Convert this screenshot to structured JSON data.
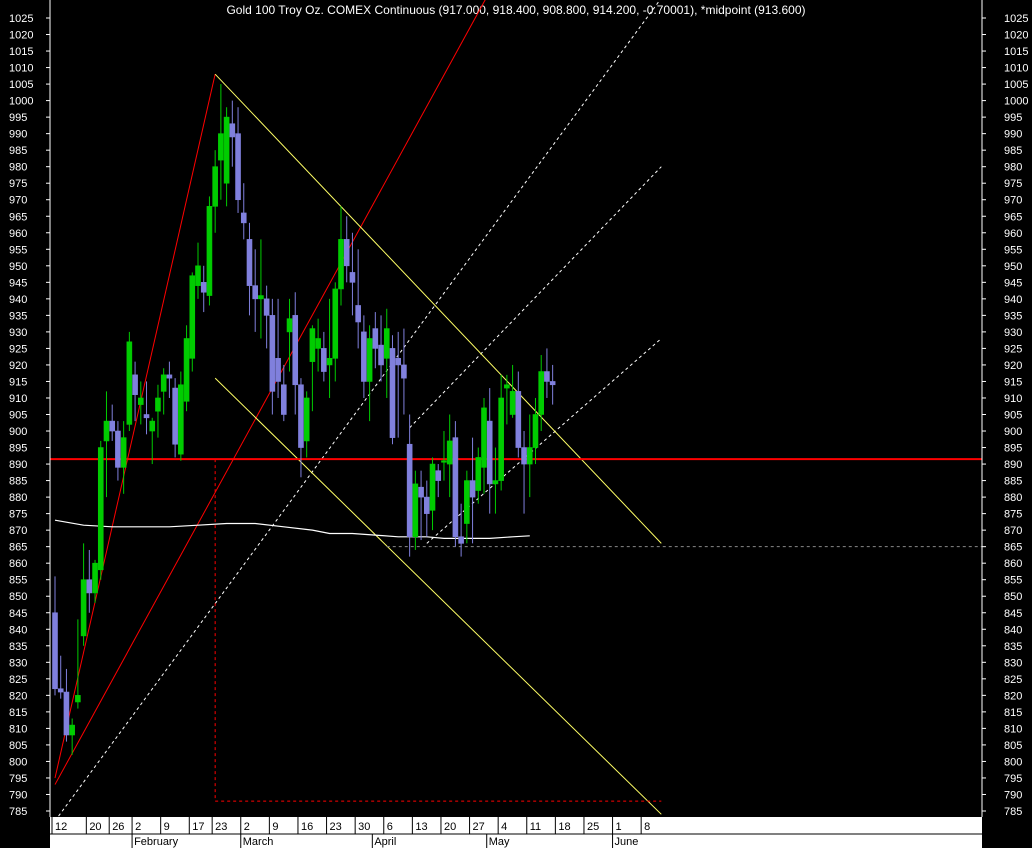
{
  "chart_data": {
    "type": "candlestick",
    "title": "Gold 100 Troy Oz. COMEX Continuous (917.000, 918.400, 908.800, 914.200, -0.70001), *midpoint (913.600)",
    "ylim": [
      785,
      1025
    ],
    "y_ticks": [
      785,
      790,
      795,
      800,
      805,
      810,
      815,
      820,
      825,
      830,
      835,
      840,
      845,
      850,
      855,
      860,
      865,
      870,
      875,
      880,
      885,
      890,
      895,
      900,
      905,
      910,
      915,
      920,
      925,
      930,
      935,
      940,
      945,
      950,
      955,
      960,
      965,
      970,
      975,
      980,
      985,
      990,
      995,
      1000,
      1005,
      1010,
      1015,
      1020,
      1025
    ],
    "x_day_ticks": [
      {
        "label": "12",
        "i": 0
      },
      {
        "label": "20",
        "i": 6
      },
      {
        "label": "26",
        "i": 10
      },
      {
        "label": "2",
        "i": 14
      },
      {
        "label": "9",
        "i": 19
      },
      {
        "label": "17",
        "i": 24
      },
      {
        "label": "23",
        "i": 28
      },
      {
        "label": "2",
        "i": 33
      },
      {
        "label": "9",
        "i": 38
      },
      {
        "label": "16",
        "i": 43
      },
      {
        "label": "23",
        "i": 48
      },
      {
        "label": "30",
        "i": 53
      },
      {
        "label": "6",
        "i": 58
      },
      {
        "label": "13",
        "i": 63
      },
      {
        "label": "20",
        "i": 68
      },
      {
        "label": "27",
        "i": 73
      },
      {
        "label": "4",
        "i": 78
      },
      {
        "label": "11",
        "i": 83
      },
      {
        "label": "18",
        "i": 88
      },
      {
        "label": "25",
        "i": 93
      },
      {
        "label": "1",
        "i": 98
      },
      {
        "label": "8",
        "i": 103
      }
    ],
    "x_month_ticks": [
      {
        "label": "February",
        "i": 14
      },
      {
        "label": "March",
        "i": 33
      },
      {
        "label": "April",
        "i": 56
      },
      {
        "label": "May",
        "i": 76
      },
      {
        "label": "June",
        "i": 98
      }
    ],
    "candles": [
      [
        845,
        856,
        820,
        822
      ],
      [
        822,
        832,
        819,
        821
      ],
      [
        821,
        828,
        806,
        808
      ],
      [
        808,
        813,
        802,
        811
      ],
      [
        818,
        843,
        816,
        820
      ],
      [
        838,
        866,
        835,
        855
      ],
      [
        855,
        864,
        845,
        851
      ],
      [
        851,
        861,
        848,
        860
      ],
      [
        858,
        897,
        855,
        895
      ],
      [
        897,
        912,
        880,
        903
      ],
      [
        903,
        908,
        897,
        900
      ],
      [
        900,
        903,
        885,
        889
      ],
      [
        889,
        903,
        881,
        898
      ],
      [
        902,
        930,
        900,
        927
      ],
      [
        917,
        921,
        903,
        911
      ],
      [
        908,
        915,
        902,
        910
      ],
      [
        905,
        915,
        899,
        904
      ],
      [
        900,
        904,
        890,
        903
      ],
      [
        906,
        914,
        898,
        910
      ],
      [
        912,
        919,
        905,
        917
      ],
      [
        917,
        921,
        910,
        916
      ],
      [
        913,
        916,
        892,
        896
      ],
      [
        893,
        918,
        891,
        914
      ],
      [
        909,
        932,
        906,
        928
      ],
      [
        922,
        948,
        918,
        947
      ],
      [
        944,
        957,
        940,
        950
      ],
      [
        945,
        950,
        936,
        942
      ],
      [
        941,
        971,
        938,
        968
      ],
      [
        968,
        985,
        960,
        980
      ],
      [
        982,
        1005,
        970,
        990
      ],
      [
        975,
        998,
        968,
        995
      ],
      [
        993,
        1000,
        980,
        989
      ],
      [
        990,
        998,
        966,
        970
      ],
      [
        966,
        975,
        958,
        963
      ],
      [
        958,
        963,
        935,
        944
      ],
      [
        944,
        955,
        930,
        940
      ],
      [
        940,
        958,
        928,
        941
      ],
      [
        940,
        944,
        925,
        935
      ],
      [
        935,
        940,
        905,
        912
      ],
      [
        922,
        940,
        910,
        915
      ],
      [
        914,
        920,
        903,
        905
      ],
      [
        930,
        940,
        918,
        934
      ],
      [
        935,
        942,
        905,
        914
      ],
      [
        914,
        916,
        886,
        895
      ],
      [
        897,
        912,
        892,
        910
      ],
      [
        921,
        932,
        906,
        931
      ],
      [
        925,
        934,
        918,
        928
      ],
      [
        925,
        930,
        915,
        918
      ],
      [
        920,
        940,
        910,
        922
      ],
      [
        922,
        945,
        915,
        943
      ],
      [
        943,
        968,
        938,
        958
      ],
      [
        958,
        965,
        945,
        950
      ],
      [
        948,
        960,
        935,
        945
      ],
      [
        938,
        955,
        925,
        933
      ],
      [
        930,
        935,
        910,
        915
      ],
      [
        915,
        932,
        903,
        928
      ],
      [
        931,
        936,
        919,
        925
      ],
      [
        926,
        935,
        915,
        920
      ],
      [
        922,
        937,
        910,
        931
      ],
      [
        925,
        929,
        896,
        898
      ],
      [
        922,
        930,
        898,
        920
      ],
      [
        920,
        931,
        905,
        916
      ],
      [
        896,
        905,
        862,
        868
      ],
      [
        868,
        888,
        864,
        884
      ],
      [
        883,
        888,
        867,
        880
      ],
      [
        880,
        885,
        868,
        875
      ],
      [
        876,
        892,
        870,
        890
      ],
      [
        888,
        890,
        880,
        885
      ],
      [
        891,
        900,
        885,
        891
      ],
      [
        890,
        905,
        880,
        897
      ],
      [
        898,
        903,
        865,
        868
      ],
      [
        868,
        878,
        862,
        866
      ],
      [
        872,
        888,
        866,
        885
      ],
      [
        885,
        898,
        866,
        880
      ],
      [
        882,
        895,
        878,
        892
      ],
      [
        889,
        910,
        881,
        907
      ],
      [
        903,
        913,
        875,
        884
      ],
      [
        884,
        895,
        875,
        885
      ],
      [
        885,
        917,
        882,
        910
      ],
      [
        913,
        917,
        902,
        914
      ],
      [
        905,
        920,
        904,
        912
      ],
      [
        912,
        918,
        892,
        895
      ],
      [
        895,
        900,
        875,
        890
      ],
      [
        890,
        905,
        880,
        895
      ],
      [
        895,
        910,
        890,
        905
      ],
      [
        905,
        923,
        900,
        918
      ],
      [
        918,
        925,
        910,
        915
      ],
      [
        915,
        920,
        908,
        914
      ]
    ],
    "moving_average": [
      [
        0,
        873
      ],
      [
        5,
        871.5
      ],
      [
        10,
        871
      ],
      [
        15,
        871
      ],
      [
        20,
        871
      ],
      [
        25,
        871.5
      ],
      [
        30,
        872
      ],
      [
        35,
        872
      ],
      [
        40,
        871
      ],
      [
        45,
        870
      ],
      [
        48,
        869
      ],
      [
        52,
        869
      ],
      [
        56,
        868.5
      ],
      [
        60,
        868
      ],
      [
        65,
        868
      ],
      [
        68,
        867.5
      ],
      [
        72,
        867.5
      ],
      [
        76,
        867.5
      ],
      [
        80,
        868
      ],
      [
        83,
        868.3
      ]
    ],
    "horizontal_levels": [
      {
        "value": 891.5,
        "color": "#ff0000",
        "style": "solid"
      },
      {
        "value": 865.0,
        "color": "#888888",
        "style": "dashed",
        "from_i": 58
      }
    ],
    "trendlines": [
      {
        "color": "#ff0000",
        "style": "solid",
        "p1": [
          0,
          795
        ],
        "p2": [
          28,
          1008
        ]
      },
      {
        "color": "#ff0000",
        "style": "solid",
        "p1": [
          0,
          793
        ],
        "p2": [
          76,
          1033
        ]
      },
      {
        "color": "#ffffff",
        "style": "dashed",
        "p1": [
          0,
          782
        ],
        "p2": [
          106,
          1031
        ]
      },
      {
        "color": "#ffffff",
        "style": "dashed",
        "p1": [
          62,
          901
        ],
        "p2": [
          106,
          980
        ]
      },
      {
        "color": "#ffffff",
        "style": "dashed",
        "p1": [
          65,
          866
        ],
        "p2": [
          106,
          928
        ]
      },
      {
        "color": "#ffff66",
        "style": "solid",
        "p1": [
          28,
          1008
        ],
        "p2": [
          106,
          866
        ]
      },
      {
        "color": "#ffff66",
        "style": "solid",
        "p1": [
          28,
          916
        ],
        "p2": [
          106,
          784
        ]
      },
      {
        "color": "#ff0000",
        "style": "dashed",
        "p1": [
          28,
          891.5
        ],
        "p2": [
          28,
          788
        ]
      },
      {
        "color": "#ff0000",
        "style": "dashed",
        "p1": [
          28,
          788
        ],
        "p2": [
          106,
          788
        ]
      }
    ],
    "colors": {
      "up_candle": "#00cc00",
      "down_candle": "#8080dd",
      "background": "#000000",
      "axis_bar": "#ffffff",
      "ma_line": "#ffffff"
    }
  }
}
